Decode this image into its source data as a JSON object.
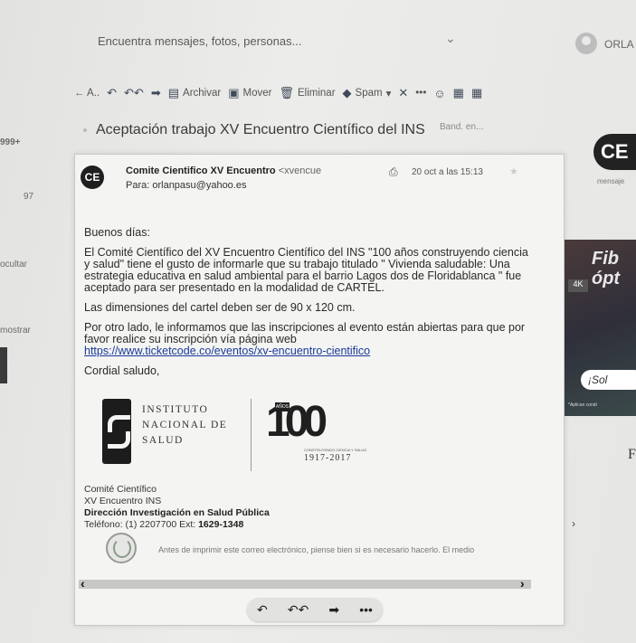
{
  "header": {
    "search_placeholder": "Encuentra mensajes, fotos, personas...",
    "chevron": "⌄",
    "user_name": "ORLA"
  },
  "toolbar": {
    "back": "← A..",
    "archive": "Archivar",
    "move": "Mover",
    "delete": "Eliminar",
    "spam": "Spam",
    "more": "•••"
  },
  "left_column": {
    "count1": "999+",
    "count2": "97",
    "item1": "ocultar",
    "item2": "mostrar"
  },
  "message": {
    "subject": "Aceptación trabajo XV Encuentro Científico del INS",
    "folder": "Band. en...",
    "avatar_text": "CE",
    "sender_name": "Comite Cientifico XV Encuentro",
    "sender_email": "<xvencue",
    "recipient": "Para: orlanpasu@yahoo.es",
    "date": "20 oct a las 15:13",
    "greeting": "Buenos días:",
    "paragraph1": "El Comité Científico del XV Encuentro Científico del INS \"100 años construyendo ciencia y salud\" tiene el gusto de informarle que su trabajo titulado  \" Vivienda saludable: Una estrategia educativa en salud ambiental para el barrio Lagos dos de Floridablanca \"   fue aceptado para ser presentado en la modalidad de CARTEL.",
    "paragraph2": "Las dimensiones del cartel deben ser de 90 x 120 cm.",
    "paragraph3": "Por otro lado, le informamos que las inscripciones al evento están abiertas para que por favor realice su inscripción vía página web",
    "link": "https://www.ticketcode.co/eventos/xv-encuentro-cientifico",
    "closing": "Cordial saludo,",
    "logo_ins_line1": "INSTITUTO",
    "logo_ins_line2": "NACIONAL DE",
    "logo_ins_line3": "SALUD",
    "logo_100": "100",
    "logo_anos": "AÑOS",
    "logo_years_subtitle": "CONSTRUYENDO CIENCIA Y SALUD",
    "logo_years": "1917-2017",
    "sig_line1": "Comité Científico",
    "sig_line2": "XV Encuentro INS",
    "sig_line3": "Dirección Investigación en Salud Pública",
    "sig_phone_label": "Teléfono: (1) 2207700 Ext: ",
    "sig_phone_ext": "1629-1348",
    "footer_note": "Antes de imprimir este correo electrónico, piense bien si es necesario hacerlo. El medio"
  },
  "ads": {
    "ce_text": "CE",
    "mensaje": "mensaje",
    "fib_line1": "Fib",
    "fib_line2": "ópt",
    "badge_4k": "4K",
    "button": "¡Sol",
    "conditions": "*Aplican condi",
    "letter": "F"
  }
}
